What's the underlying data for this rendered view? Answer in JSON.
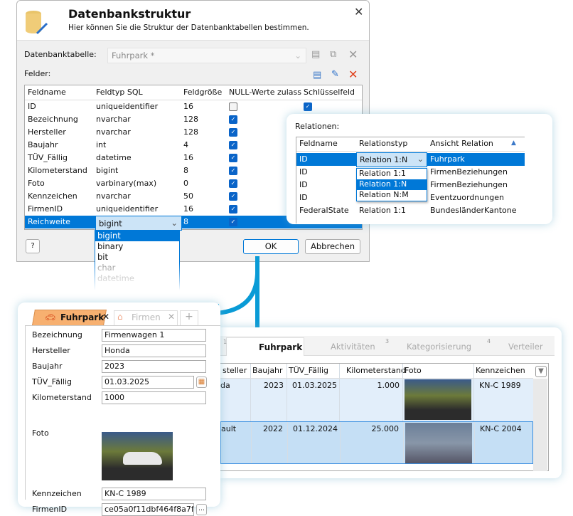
{
  "dialog": {
    "title": "Datenbankstruktur",
    "subtitle": "Hier können Sie die Struktur der Datenbanktabellen bestimmen.",
    "table_label": "Datenbanktabelle:",
    "table_value": "Fuhrpark *",
    "fields_label": "Felder:",
    "columns": [
      "Feldname",
      "Feldtyp SQL",
      "Feldgröße",
      "NULL-Werte zulass",
      "Schlüsselfeld"
    ],
    "rows": [
      {
        "name": "ID",
        "type": "uniqueidentifier",
        "size": "16",
        "nullable": false,
        "key": true
      },
      {
        "name": "Bezeichnung",
        "type": "nvarchar",
        "size": "128",
        "nullable": true,
        "key": false
      },
      {
        "name": "Hersteller",
        "type": "nvarchar",
        "size": "128",
        "nullable": true,
        "key": false
      },
      {
        "name": "Baujahr",
        "type": "int",
        "size": "4",
        "nullable": true,
        "key": false
      },
      {
        "name": "TÜV_Fällig",
        "type": "datetime",
        "size": "16",
        "nullable": true,
        "key": false
      },
      {
        "name": "Kilometerstand",
        "type": "bigint",
        "size": "8",
        "nullable": true,
        "key": false
      },
      {
        "name": "Foto",
        "type": "varbinary(max)",
        "size": "0",
        "nullable": true,
        "key": false
      },
      {
        "name": "Kennzeichen",
        "type": "nvarchar",
        "size": "50",
        "nullable": true,
        "key": false
      },
      {
        "name": "FirmenID",
        "type": "uniqueidentifier",
        "size": "16",
        "nullable": true,
        "key": false
      },
      {
        "name": "Reichweite",
        "type": "bigint",
        "size": "8",
        "nullable": true,
        "key": false
      }
    ],
    "type_options": [
      "bigint",
      "binary",
      "bit",
      "char",
      "datetime"
    ],
    "ok": "OK",
    "cancel": "Abbrechen"
  },
  "relations": {
    "label": "Relationen:",
    "columns": [
      "Feldname",
      "Relationstyp",
      "Ansicht Relation"
    ],
    "rows": [
      {
        "field": "ID",
        "type": "Relation 1:N",
        "view": "Fuhrpark"
      },
      {
        "field": "ID",
        "type": "",
        "view": "FirmenBeziehungen"
      },
      {
        "field": "ID",
        "type": "",
        "view": "FirmenBeziehungen"
      },
      {
        "field": "ID",
        "type": "",
        "view": "Eventzuordnungen"
      },
      {
        "field": "FederalState",
        "type": "Relation 1:1",
        "view": "BundesländerKantone"
      }
    ],
    "type_options": [
      "Relation 1:1",
      "Relation 1:N",
      "Relation N:M"
    ]
  },
  "grid": {
    "tabs": [
      {
        "num": "1",
        "label": "Fuhrpark"
      },
      {
        "num": "",
        "label": "Aktivitäten"
      },
      {
        "num": "3",
        "label": "Kategorisierung"
      },
      {
        "num": "4",
        "label": "Verteiler"
      }
    ],
    "columns": [
      "steller",
      "Baujahr",
      "TÜV_Fällig",
      "Kilometerstand",
      "Foto",
      "Kennzeichen"
    ],
    "rows": [
      {
        "maker": "da",
        "year": "2023",
        "tuev": "01.03.2025",
        "km": "1.000",
        "plate": "KN-C 1989"
      },
      {
        "maker": "ault",
        "year": "2022",
        "tuev": "01.12.2024",
        "km": "25.000",
        "plate": "KN-C 2004"
      }
    ]
  },
  "form": {
    "tabs": [
      {
        "label": "Fuhrpark"
      },
      {
        "label": "Firmen"
      }
    ],
    "fields": [
      {
        "label": "Bezeichnung",
        "value": "Firmenwagen 1"
      },
      {
        "label": "Hersteller",
        "value": "Honda"
      },
      {
        "label": "Baujahr",
        "value": "2023"
      },
      {
        "label": "TÜV_Fällig",
        "value": "01.03.2025"
      },
      {
        "label": "Kilometerstand",
        "value": "1000"
      }
    ],
    "foto_label": "Foto",
    "kennzeichen_label": "Kennzeichen",
    "kennzeichen_value": "KN-C 1989",
    "firmenid_label": "FirmenID",
    "firmenid_value": "ce05a0f11dbf464f8a7f"
  },
  "colors": {
    "accent": "#0078d7",
    "arrow": "#0a9bd6",
    "tab_active": "#f7b070"
  }
}
